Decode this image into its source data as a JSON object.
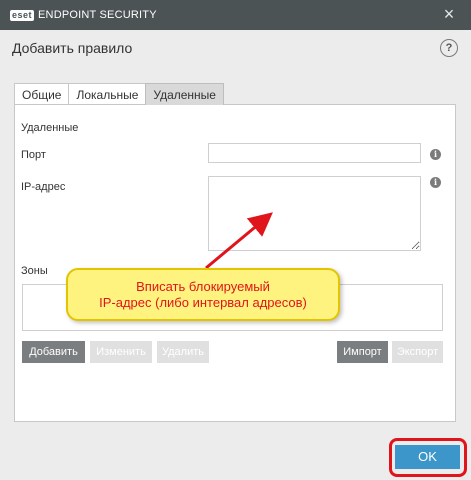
{
  "titlebar": {
    "brand_badge": "eset",
    "product_name": "ENDPOINT SECURITY",
    "close_glyph": "×"
  },
  "header": {
    "title": "Добавить правило",
    "help_glyph": "?"
  },
  "tabs": [
    {
      "label": "Общие",
      "active": false
    },
    {
      "label": "Локальные",
      "active": false
    },
    {
      "label": "Удаленные",
      "active": true
    }
  ],
  "form": {
    "section_title": "Удаленные",
    "port_label": "Порт",
    "port_value": "",
    "ip_label": "IP-адрес",
    "ip_value": "",
    "zones_label": "Зоны"
  },
  "buttons": {
    "add": "Добавить",
    "edit": "Изменить",
    "delete": "Удалить",
    "import": "Импорт",
    "export": "Экспорт",
    "ok": "OK"
  },
  "annotation": {
    "line1": "Вписать блокируемый",
    "line2": "IP-адрес (либо интервал адресов)"
  },
  "icons": {
    "info": "info-icon",
    "help": "help-icon",
    "close": "close-icon"
  },
  "colors": {
    "titlebar": "#4b5355",
    "accent": "#3d96c9",
    "highlight": "#e0151b",
    "callout": "#fff37f"
  }
}
